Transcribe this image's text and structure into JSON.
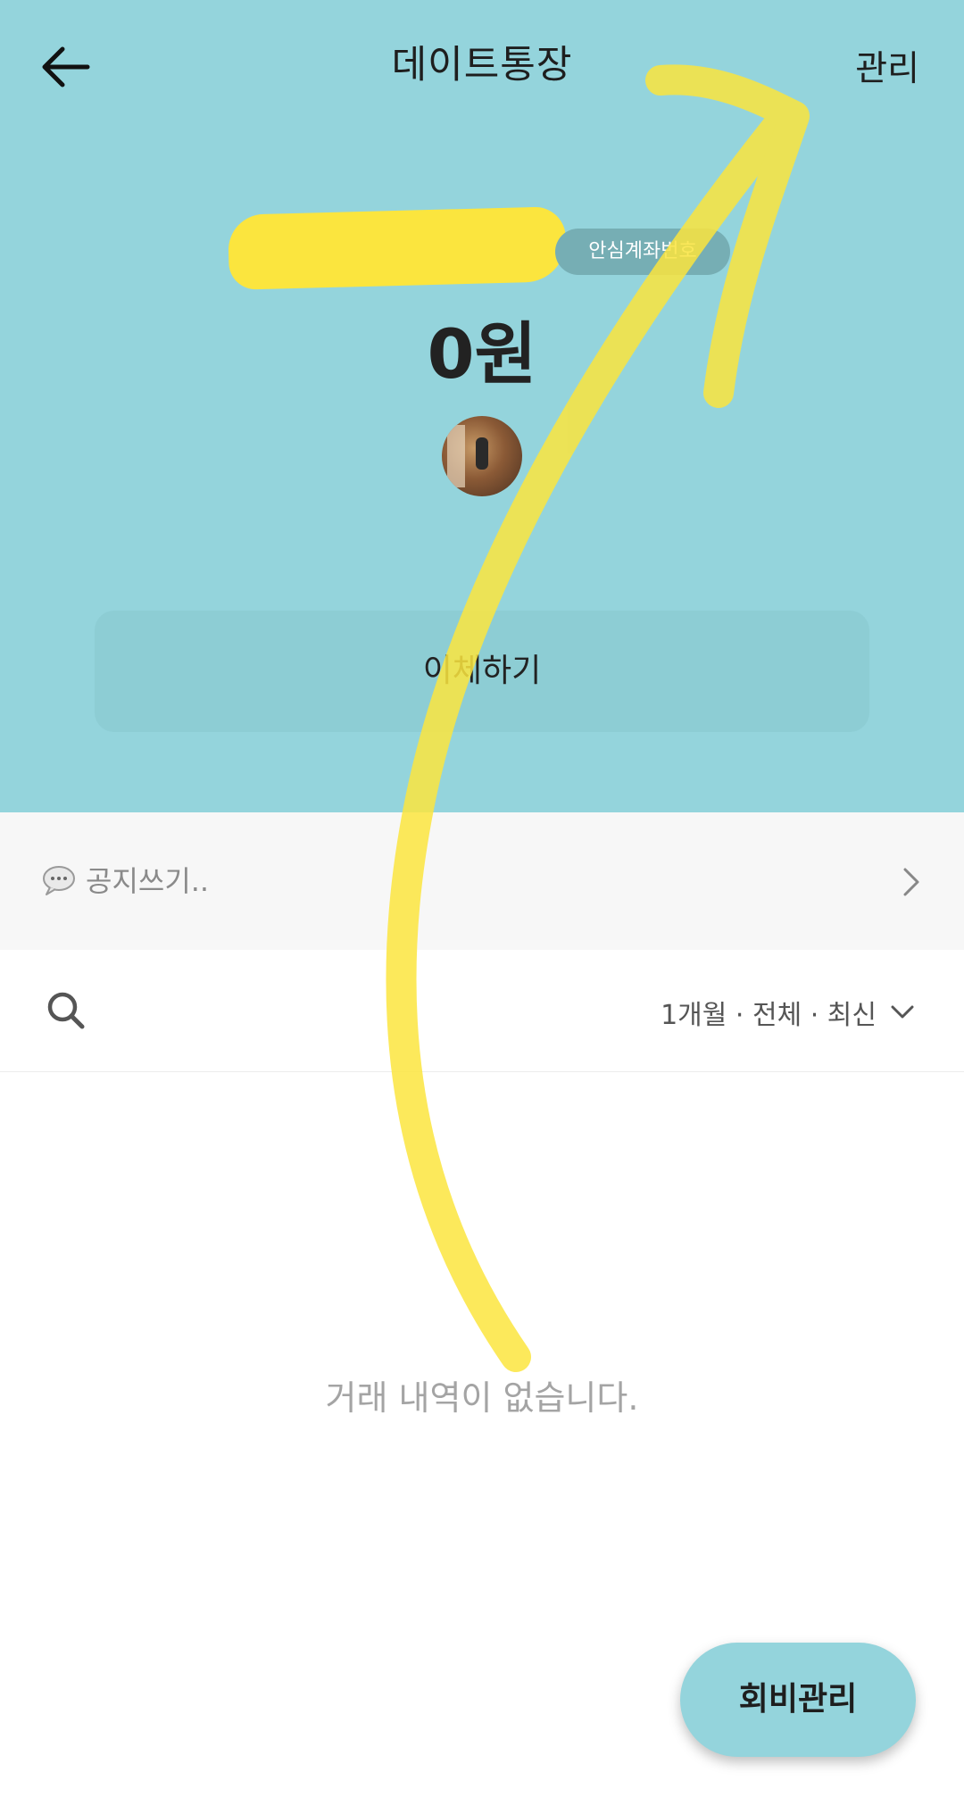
{
  "header": {
    "title": "데이트통장",
    "manage_label": "관리",
    "safe_account_badge": "안심계좌번호",
    "balance": "0원",
    "transfer_label": "이체하기"
  },
  "notice": {
    "placeholder": "공지쓰기.."
  },
  "filter": {
    "label": "1개월 · 전체 · 최신"
  },
  "transactions": {
    "empty_message": "거래 내역이 없습니다."
  },
  "fab": {
    "label": "회비관리"
  },
  "icons": {
    "back": "arrow-left-icon",
    "notice": "speech-bubble-icon",
    "chevron": "chevron-right-icon",
    "search": "search-icon",
    "dropdown": "chevron-down-icon"
  },
  "colors": {
    "header_bg": "#94D4DC",
    "transfer_bg": "#8DCDD4",
    "badge_bg": "#76AEB4",
    "highlight": "#FBE53E"
  }
}
